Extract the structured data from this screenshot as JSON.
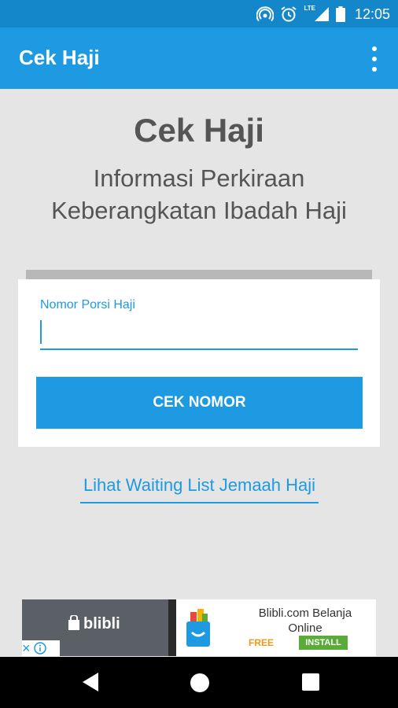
{
  "status_bar": {
    "time": "12:05",
    "network_label": "LTE",
    "icons": [
      "hotspot-icon",
      "alarm-icon",
      "signal-icon",
      "battery-icon"
    ]
  },
  "app_bar": {
    "title": "Cek Haji",
    "menu_icon": "overflow-menu-icon"
  },
  "header": {
    "title": "Cek Haji",
    "subtitle_line1": "Informasi Perkiraan",
    "subtitle_line2": "Keberangkatan Ibadah Haji"
  },
  "form": {
    "field_label": "Nomor Porsi Haji",
    "field_value": "",
    "submit_label": "CEK NOMOR"
  },
  "waiting_list_link": "Lihat Waiting List Jemaah Haji",
  "ad": {
    "brand": "blibli",
    "title_line1": "Blibli.com Belanja",
    "title_line2": "Online",
    "price": "FREE",
    "install_label": "INSTALL"
  },
  "colors": {
    "primary": "#1d9ae1",
    "status_bar": "#1387c9",
    "background": "#e5e5e5",
    "text": "#555555"
  }
}
